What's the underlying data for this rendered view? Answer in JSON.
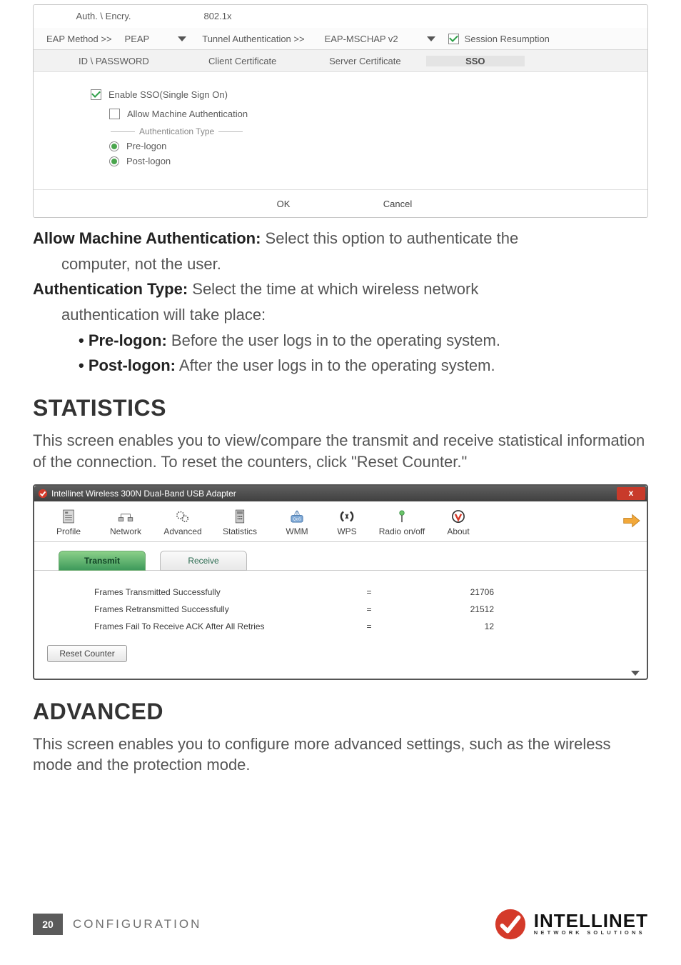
{
  "fig1": {
    "tabs": [
      "Auth. \\ Encry.",
      "802.1x"
    ],
    "row2": {
      "eap_label": "EAP Method >>",
      "eap_value": "PEAP",
      "tun_label": "Tunnel Authentication >>",
      "tun_value": "EAP-MSCHAP v2",
      "session": "Session Resumption"
    },
    "row3": [
      "ID \\ PASSWORD",
      "Client Certificate",
      "Server Certificate",
      "SSO"
    ],
    "body": {
      "enable_sso": "Enable SSO(Single Sign On)",
      "allow_machine": "Allow Machine Authentication",
      "auth_type": "Authentication Type",
      "pre": "Pre-logon",
      "post": "Post-logon"
    },
    "foot": {
      "ok": "OK",
      "cancel": "Cancel"
    }
  },
  "prose": {
    "ama_b": "Allow Machine Authentication:",
    "ama_t": " Select this option to authenticate the",
    "ama_t2": "computer, not the user.",
    "at_b": "Authentication Type:",
    "at_t": " Select the time at which wireless network",
    "at_t2": "authentication will take place:",
    "pre_b": "• Pre-logon:",
    "pre_t": " Before the user logs in to the operating system.",
    "post_b": "• Post-logon:",
    "post_t": " After the user logs in to the operating system."
  },
  "h_stats": "STATISTICS",
  "stats_intro": "This screen enables you to view/compare the transmit and receive statistical information of the connection. To reset the counters, click \"Reset Counter.\"",
  "fig2": {
    "title": "Intellinet Wireless 300N Dual-Band USB Adapter",
    "close": "x",
    "toolbar": [
      "Profile",
      "Network",
      "Advanced",
      "Statistics",
      "WMM",
      "WPS",
      "Radio on/off",
      "About"
    ],
    "subtabs": {
      "transmit": "Transmit",
      "receive": "Receive"
    },
    "rows": [
      {
        "k": "Frames Transmitted Successfully",
        "v": "21706"
      },
      {
        "k": "Frames Retransmitted Successfully",
        "v": "21512"
      },
      {
        "k": "Frames Fail To Receive ACK After All Retries",
        "v": "12"
      }
    ],
    "reset": "Reset Counter"
  },
  "h_adv": "ADVANCED",
  "adv_intro": "This screen enables you to configure more advanced settings, such as the wireless mode and the protection mode.",
  "footer": {
    "page": "20",
    "section": "CONFIGURATION",
    "brand": "INTELLINET",
    "brand_sub": "NETWORK SOLUTIONS"
  }
}
